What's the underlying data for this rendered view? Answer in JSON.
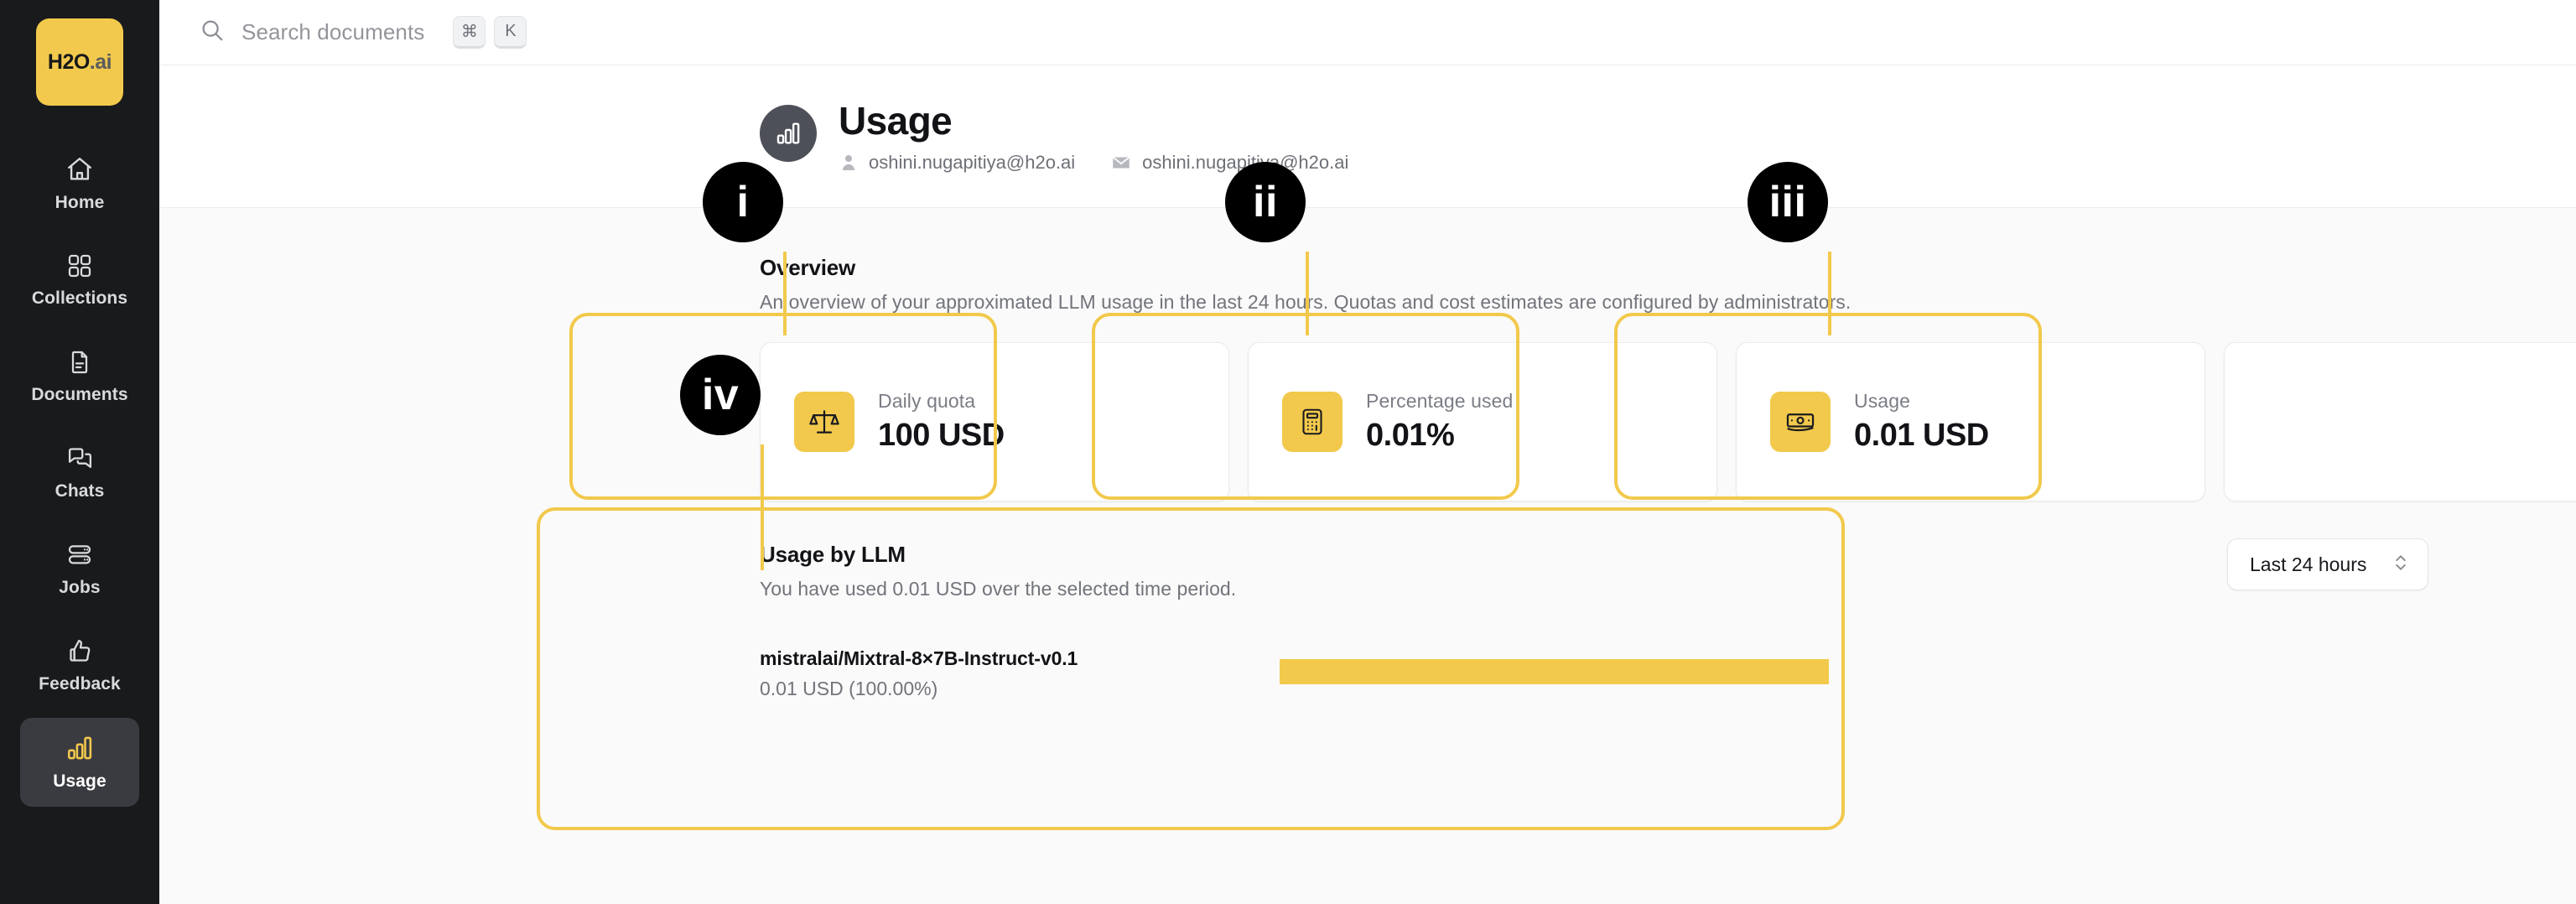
{
  "brand": {
    "name_main": "H2O",
    "name_dim": ".ai"
  },
  "sidebar": {
    "items": [
      {
        "label": "Home",
        "icon": "home-icon",
        "active": false
      },
      {
        "label": "Collections",
        "icon": "collections-icon",
        "active": false
      },
      {
        "label": "Documents",
        "icon": "documents-icon",
        "active": false
      },
      {
        "label": "Chats",
        "icon": "chats-icon",
        "active": false
      },
      {
        "label": "Jobs",
        "icon": "jobs-icon",
        "active": false
      },
      {
        "label": "Feedback",
        "icon": "feedback-icon",
        "active": false
      },
      {
        "label": "Usage",
        "icon": "usage-icon",
        "active": true
      }
    ]
  },
  "topbar": {
    "search_placeholder": "Search documents",
    "shortcut_keys": [
      "⌘",
      "K"
    ],
    "avatar_icon": "user-icon"
  },
  "page": {
    "title": "Usage",
    "title_icon": "bar-chart-icon",
    "user_name": "oshini.nugapitiya@h2o.ai",
    "user_email": "oshini.nugapitiya@h2o.ai"
  },
  "overview": {
    "heading": "Overview",
    "description": "An overview of your approximated LLM usage in the last 24 hours. Quotas and cost estimates are configured by administrators.",
    "cards": [
      {
        "label": "Daily quota",
        "value": "100 USD",
        "icon": "scales-icon"
      },
      {
        "label": "Percentage used",
        "value": "0.01%",
        "icon": "calculator-icon"
      },
      {
        "label": "Usage",
        "value": "0.01 USD",
        "icon": "banknote-icon"
      },
      {
        "label": "",
        "value": "",
        "icon": ""
      }
    ]
  },
  "usage_by_llm": {
    "heading": "Usage by LLM",
    "description": "You have used 0.01 USD over the selected time period.",
    "time_range_selected": "Last 24 hours",
    "rows": [
      {
        "model": "mistralai/Mixtral-8×7B-Instruct-v0.1",
        "cost": "0.01 USD (100.00%)",
        "percent": 100
      }
    ]
  },
  "annotations": [
    {
      "numeral": "i"
    },
    {
      "numeral": "ii"
    },
    {
      "numeral": "iii"
    },
    {
      "numeral": "iv"
    }
  ],
  "colors": {
    "accent": "#f2c94c",
    "sidebar_bg": "#191a1c",
    "page_bg": "#fafafa"
  }
}
